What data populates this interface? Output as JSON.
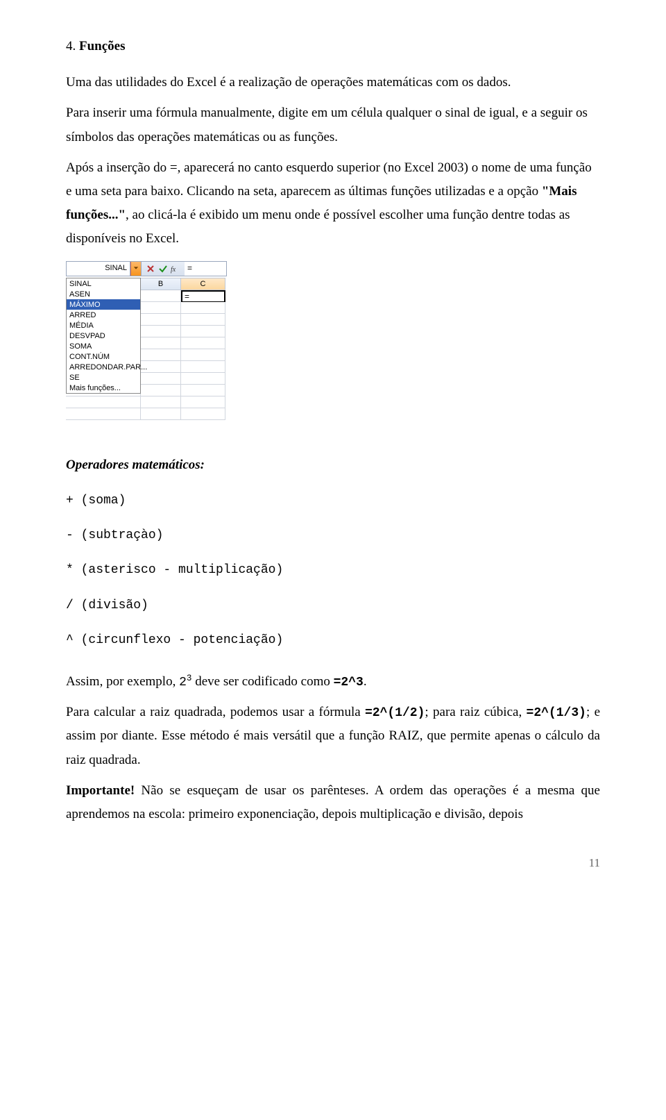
{
  "heading_num": "4.",
  "heading_title": "Funções",
  "p1": "Uma das utilidades do Excel é a realização de operações matemáticas com os dados.",
  "p2": "Para inserir uma fórmula manualmente, digite em um célula qualquer o sinal de igual, e a seguir os símbolos das operações matemáticas ou as funções.",
  "p3a": "Após a inserção do =, aparecerá no canto esquerdo superior (no Excel 2003) o nome de uma função e uma seta para baixo. Clicando na seta, aparecem as últimas funções utilizadas e a opção ",
  "p3b": "\"Mais funções...\"",
  "p3c": ", ao clicá-la é exibido um menu onde é possível escolher uma função dentre todas as disponíveis no Excel.",
  "excel": {
    "name_box": "SINAL",
    "fx_value": "=",
    "col_B": "B",
    "col_C": "C",
    "active_cell": "=",
    "options": [
      "SINAL",
      "ASEN",
      "MÁXIMO",
      "ARRED",
      "MÉDIA",
      "DESVPAD",
      "SOMA",
      "CONT.NÚM",
      "ARREDONDAR.PAR...",
      "SE",
      "Mais funções..."
    ],
    "highlight_index": 2
  },
  "ops_heading": "Operadores matemáticos:",
  "ops": {
    "soma": "+ (soma)",
    "sub": "- (subtraçào)",
    "mult": "* (asterisco - multiplicação)",
    "div": "/ (divisão)",
    "pot": "^ (circunflexo - potenciação)"
  },
  "ex1a": "Assim, por exemplo, ",
  "ex1b_base": "2",
  "ex1b_exp": "3",
  "ex1c": " deve ser codificado como  ",
  "ex1d": "=2^3",
  "ex1e": ".",
  "p4a": "Para calcular a raiz quadrada, podemos usar a fórmula ",
  "p4b": "=2^(1/2)",
  "p4c": ";  para raiz cúbica, ",
  "p4d": "=2^(1/3)",
  "p4e": "; e assim por diante. Esse método é mais versátil que a função RAIZ, que permite apenas o cálculo da raiz quadrada.",
  "p5a": "Importante!",
  "p5b": " Não se esqueçam de usar os parênteses. A ordem das operações é a mesma que aprendemos na escola: primeiro exponenciação, depois multiplicação e divisão, depois",
  "page_num": "11"
}
